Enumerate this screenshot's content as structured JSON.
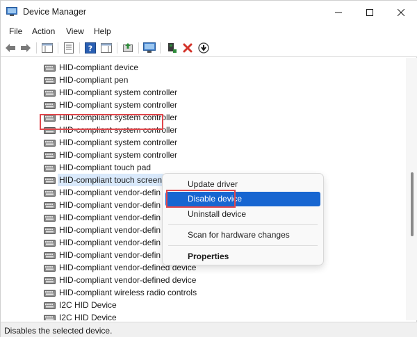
{
  "window": {
    "title": "Device Manager"
  },
  "menubar": {
    "items": [
      "File",
      "Action",
      "View",
      "Help"
    ]
  },
  "toolbar": {
    "icons": [
      "back-arrow-icon",
      "forward-arrow-icon",
      "properties-grid-icon",
      "list-view-icon",
      "help-icon",
      "console-icon",
      "update-driver-icon",
      "monitor-icon",
      "enable-device-icon",
      "uninstall-x-icon",
      "disable-device-icon"
    ],
    "accent_red": "#d3332a",
    "accent_green": "#2e8b3a"
  },
  "tree": {
    "rows": [
      "HID-compliant device",
      "HID-compliant pen",
      "HID-compliant system controller",
      "HID-compliant system controller",
      "HID-compliant system controller",
      "HID-compliant system controller",
      "HID-compliant system controller",
      "HID-compliant system controller",
      "HID-compliant touch pad",
      "HID-compliant touch screen",
      "HID-compliant vendor-defin",
      "HID-compliant vendor-defin",
      "HID-compliant vendor-defin",
      "HID-compliant vendor-defin",
      "HID-compliant vendor-defin",
      "HID-compliant vendor-defin",
      "HID-compliant vendor-defined device",
      "HID-compliant vendor-defined device",
      "HID-compliant wireless radio controls",
      "I2C HID Device",
      "I2C HID Device"
    ],
    "selected_index": 9
  },
  "context_menu": {
    "update_driver": "Update driver",
    "disable_device": "Disable device",
    "uninstall_device": "Uninstall device",
    "scan_hardware": "Scan for hardware changes",
    "properties": "Properties"
  },
  "status": {
    "text": "Disables the selected device."
  },
  "colors": {
    "highlight_box": "#e0474c",
    "menu_active": "#1766d1"
  }
}
